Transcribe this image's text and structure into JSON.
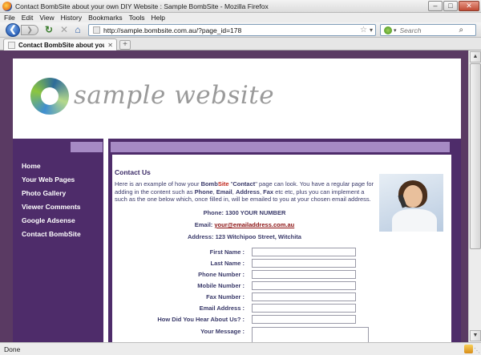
{
  "window": {
    "title": "Contact BombSite about your own DIY Website : Sample BombSite - Mozilla Firefox",
    "minimize_glyph": "–",
    "maximize_glyph": "□",
    "close_glyph": "✕"
  },
  "menu": [
    "File",
    "Edit",
    "View",
    "History",
    "Bookmarks",
    "Tools",
    "Help"
  ],
  "navigation": {
    "back_glyph": "❮",
    "forward_glyph": "❯",
    "reload_glyph": "↻",
    "stop_glyph": "✕",
    "home_glyph": "⌂",
    "url": "http://sample.bombsite.com.au/?page_id=178",
    "star_glyph": "☆",
    "url_drop_glyph": "▾",
    "search_placeholder": "Search",
    "search_drop_glyph": "▾",
    "search_go_glyph": "⌕"
  },
  "tabs": [
    {
      "label": "Contact BombSite about your own DI...",
      "close_glyph": "✕"
    }
  ],
  "newtab_glyph": "+",
  "site": {
    "logo_text": "sample website",
    "nav_items": [
      "Home",
      "Your Web Pages",
      "Photo Gallery",
      "Viewer Comments",
      "Google Adsense",
      "Contact BombSite"
    ],
    "heading": "Contact Us",
    "intro": {
      "part1": "Here is an example of how your ",
      "brand_bomb": "Bomb",
      "brand_site": "Site",
      "part2": " \"",
      "contact_word": "Contact",
      "part3": "\" page can look. You have a regular page for adding in the content such as ",
      "w_phone": "Phone",
      "sep1": ", ",
      "w_email": "Email",
      "sep2": ", ",
      "w_address": "Address",
      "sep3": ", ",
      "w_fax": "Fax",
      "part4": " etc etc, plus you can implement a such as the one below which, once filled in, will be emailed to you at your chosen email address."
    },
    "phone_line": "Phone: 1300 YOUR NUMBER",
    "email_label": "Email: ",
    "email_value": "your@emailaddress.com.au",
    "address_line": "Address: 123 Witchipoo Street, Witchita",
    "form": {
      "fields": [
        {
          "label": "First Name :",
          "value": ""
        },
        {
          "label": "Last Name :",
          "value": ""
        },
        {
          "label": "Phone Number :",
          "value": ""
        },
        {
          "label": "Mobile Number :",
          "value": ""
        },
        {
          "label": "Fax Number :",
          "value": ""
        },
        {
          "label": "Email Address :",
          "value": ""
        },
        {
          "label": "How Did You Hear About Us? :",
          "value": ""
        }
      ],
      "message_label": "Your Message :",
      "message_value": ""
    }
  },
  "status": {
    "text": "Done"
  },
  "colors": {
    "site_purple": "#4e2c6a",
    "site_light_purple": "#a68ac4",
    "outer_purple": "#5a3a63",
    "red_highlight": "#c0281e"
  }
}
